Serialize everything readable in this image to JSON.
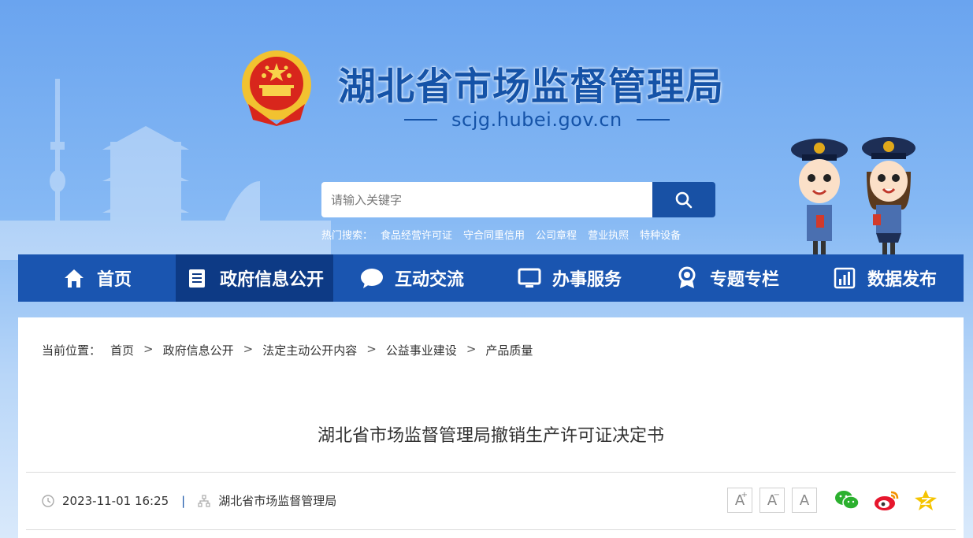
{
  "header": {
    "site_title": "湖北省市场监督管理局",
    "domain": "scjg.hubei.gov.cn"
  },
  "search": {
    "placeholder": "请输入关键字",
    "button_icon": "search-icon"
  },
  "hot_search": {
    "label": "热门搜索：",
    "items": [
      "食品经营许可证",
      "守合同重信用",
      "公司章程",
      "营业执照",
      "特种设备"
    ]
  },
  "nav": {
    "items": [
      {
        "label": "首页",
        "icon": "home-icon"
      },
      {
        "label": "政府信息公开",
        "icon": "document-icon",
        "active": true
      },
      {
        "label": "互动交流",
        "icon": "chat-bubble-icon"
      },
      {
        "label": "办事服务",
        "icon": "monitor-icon"
      },
      {
        "label": "专题专栏",
        "icon": "award-icon"
      },
      {
        "label": "数据发布",
        "icon": "bar-chart-icon"
      }
    ]
  },
  "breadcrumb": {
    "label": "当前位置：",
    "items": [
      "首页",
      "政府信息公开",
      "法定主动公开内容",
      "公益事业建设",
      "产品质量"
    ],
    "separator": ">"
  },
  "article": {
    "title": "湖北省市场监督管理局撤销生产许可证决定书",
    "date": "2023-11-01 16:25",
    "source": "湖北省市场监督管理局",
    "meta_separator": "|"
  },
  "font_tools": [
    "A",
    "A",
    "A"
  ],
  "share": [
    "wechat-icon",
    "weibo-icon",
    "qzone-icon"
  ],
  "colors": {
    "brand_blue": "#1a55b0",
    "nav_active": "#0d3a85",
    "title_blue": "#1553a8"
  }
}
